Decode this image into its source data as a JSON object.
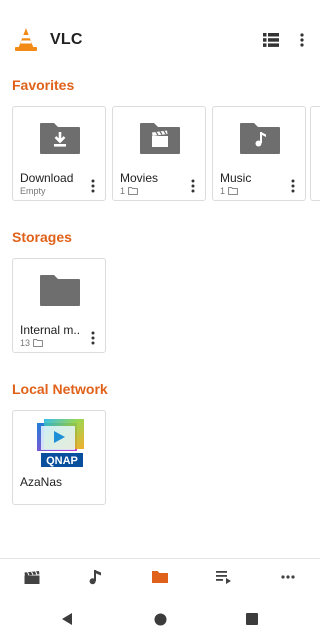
{
  "app": {
    "title": "VLC",
    "accent": "#e0621a",
    "icons": {
      "logo": "vlc-cone-icon",
      "list": "list-view-icon",
      "more": "more-vert-icon"
    }
  },
  "favorites": {
    "title": "Favorites",
    "items": [
      {
        "label": "Download",
        "sub": "Empty",
        "icon": "download-folder-icon"
      },
      {
        "label": "Movies",
        "sub": "1",
        "icon": "movies-folder-icon"
      },
      {
        "label": "Music",
        "sub": "1",
        "icon": "music-folder-icon"
      }
    ]
  },
  "storages": {
    "title": "Storages",
    "items": [
      {
        "label": "Internal m..",
        "sub": "13",
        "icon": "folder-icon"
      }
    ]
  },
  "network": {
    "title": "Local Network",
    "items": [
      {
        "label": "AzaNas",
        "icon": "qnap-logo",
        "logo_text": "QNAP"
      }
    ]
  },
  "bottom_nav": {
    "active_index": 2,
    "items": [
      {
        "name": "video",
        "icon": "clapperboard-icon"
      },
      {
        "name": "audio",
        "icon": "music-note-icon"
      },
      {
        "name": "browse",
        "icon": "folder-icon"
      },
      {
        "name": "playlists",
        "icon": "playlist-icon"
      },
      {
        "name": "more",
        "icon": "more-horiz-icon"
      }
    ]
  },
  "system_nav": {
    "icons": [
      "back-icon",
      "home-icon",
      "recents-icon"
    ]
  }
}
